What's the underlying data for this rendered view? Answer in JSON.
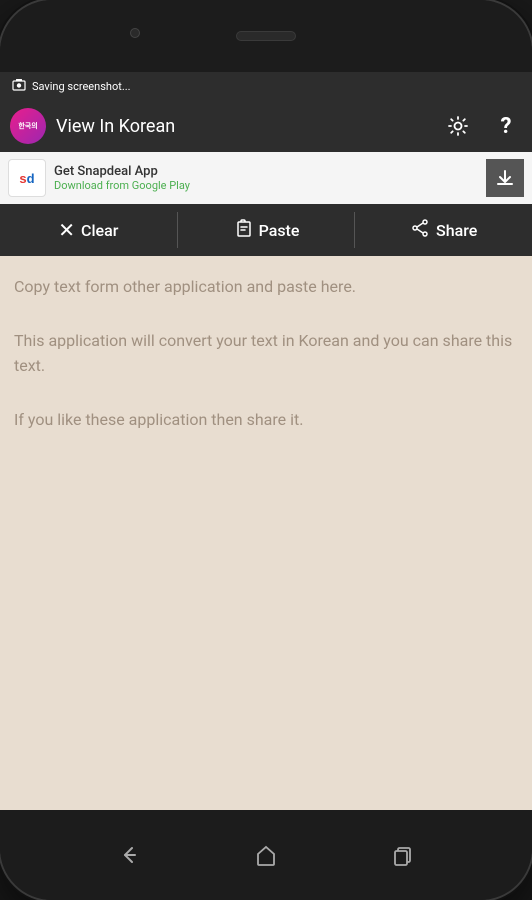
{
  "statusBar": {
    "icon": "screenshot-icon",
    "text": "Saving screenshot..."
  },
  "appBar": {
    "iconText": "한국의",
    "title": "View In Korean",
    "settingsLabel": "settings",
    "helpLabel": "help"
  },
  "adBanner": {
    "appName": "Get Snapdeal App",
    "downloadText": "Download from Google Play",
    "downloadBtnLabel": "download"
  },
  "toolbar": {
    "clearLabel": "Clear",
    "pasteLabel": "Paste",
    "shareLabel": "Share"
  },
  "content": {
    "para1": "Copy text form other application and paste here.",
    "para2": "This application will convert your text in Korean and you can share this text.",
    "para3": "If you like these application then share it."
  },
  "colors": {
    "appBarBg": "#2d2d2d",
    "adBg": "#f5f5f5",
    "contentBg": "#e8ddd0",
    "placeholderText": "#a09080"
  }
}
